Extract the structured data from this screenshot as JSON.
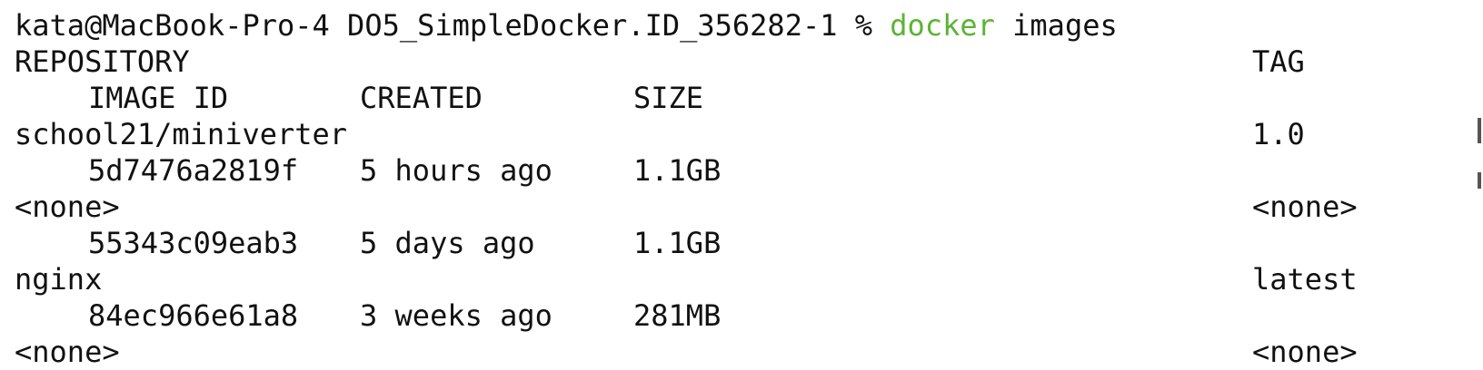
{
  "terminal": {
    "prompt": {
      "user_host": "kata@MacBook-Pro-4",
      "directory": "DO5_SimpleDocker.ID_356282-1",
      "symbol": "%",
      "command": "docker",
      "args": "images"
    },
    "headers": {
      "repository": "REPOSITORY",
      "tag": "TAG",
      "image_id": "IMAGE ID",
      "created": "CREATED",
      "size": "SIZE"
    },
    "images": [
      {
        "repository": "school21/miniverter",
        "tag": "1.0",
        "image_id": "5d7476a2819f",
        "created": "5 hours ago",
        "size": "1.1GB"
      },
      {
        "repository": "<none>",
        "tag": "<none>",
        "image_id": "55343c09eab3",
        "created": "5 days ago",
        "size": "1.1GB"
      },
      {
        "repository": "nginx",
        "tag": "latest",
        "image_id": "84ec966e61a8",
        "created": "3 weeks ago",
        "size": "281MB"
      },
      {
        "repository": "<none>",
        "tag": "<none>"
      }
    ]
  },
  "colors": {
    "background": "#ffffff",
    "text": "#111111",
    "command": "#5cb334"
  }
}
